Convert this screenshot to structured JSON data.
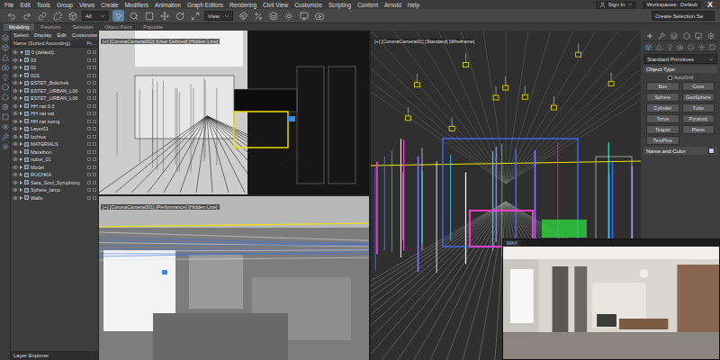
{
  "menu": [
    "File",
    "Edit",
    "Tools",
    "Group",
    "Views",
    "Create",
    "Modifiers",
    "Animation",
    "Graph Editors",
    "Rendering",
    "Civil View",
    "Customize",
    "Scripting",
    "Content",
    "Arnold",
    "Help"
  ],
  "account": {
    "sign_in": "Sign In",
    "workspaces": "Workspaces:",
    "workspace": "Default",
    "logo": "X"
  },
  "toolbar": {
    "filter": "All",
    "view": "View",
    "selection_set": "Create Selection Se"
  },
  "ribbon_tabs": [
    {
      "label": "Modeling",
      "selected": true
    },
    {
      "label": "Freeform",
      "selected": false
    },
    {
      "label": "Selection",
      "selected": false
    },
    {
      "label": "Object Paint",
      "selected": false
    },
    {
      "label": "Populate",
      "selected": false
    }
  ],
  "explorer": {
    "menu": [
      "Select",
      "Display",
      "Edit",
      "Customize"
    ],
    "columns": [
      "Name (Sorted Ascending)",
      "Fr..."
    ],
    "layers": [
      {
        "name": "0 (default)",
        "expanded": true
      },
      {
        "name": "03",
        "expanded": false
      },
      {
        "name": "02",
        "expanded": false
      },
      {
        "name": "01S",
        "expanded": false
      },
      {
        "name": "ESTET_Bobchek",
        "expanded": false
      },
      {
        "name": "ESTET_URBAN_L06",
        "expanded": false
      },
      {
        "name": "ESTET_URBAN_L06",
        "expanded": false
      },
      {
        "name": "HH nat 0.3",
        "expanded": false
      },
      {
        "name": "HH nat vat",
        "expanded": false
      },
      {
        "name": "HH nat tuong",
        "expanded": false
      },
      {
        "name": "Layer01",
        "expanded": false
      },
      {
        "name": "lochius",
        "expanded": false
      },
      {
        "name": "MATERIALS",
        "expanded": false
      },
      {
        "name": "Marathon",
        "expanded": false
      },
      {
        "name": "nobel_01",
        "expanded": false
      },
      {
        "name": "Model",
        "expanded": false
      },
      {
        "name": "RUCHKA",
        "expanded": false
      },
      {
        "name": "Sara_Soul_Symphony",
        "expanded": false
      },
      {
        "name": "Sphere_lamp",
        "expanded": false
      },
      {
        "name": "Walls",
        "expanded": false
      }
    ],
    "footer": "Layer Explorer"
  },
  "viewports": [
    {
      "label": "[+] [CoronaCamera002] [User Defined] [Hidden Line]",
      "kind": "hidden"
    },
    {
      "label": "[+] [CoronaCamera001] [Performance] [Hidden Line]",
      "kind": "clay"
    },
    {
      "label": "[+] [CoronaCamera01] [Standard] [Wireframe]",
      "kind": "wire"
    }
  ],
  "command_panel": {
    "category": "Standard Primitives",
    "object_type": "Object Type",
    "autogrid": {
      "label": "AutoGrid",
      "checked": false
    },
    "buttons": [
      "Box",
      "Cone",
      "Sphere",
      "GeoSphere",
      "Cylinder",
      "Tube",
      "Torus",
      "Pyramid",
      "Teapot",
      "Plane",
      "TextPlus"
    ],
    "name_color": {
      "title": "Name and Color",
      "swatch": "#c9c6ee"
    }
  },
  "render_window": {
    "tab": "MAX"
  }
}
